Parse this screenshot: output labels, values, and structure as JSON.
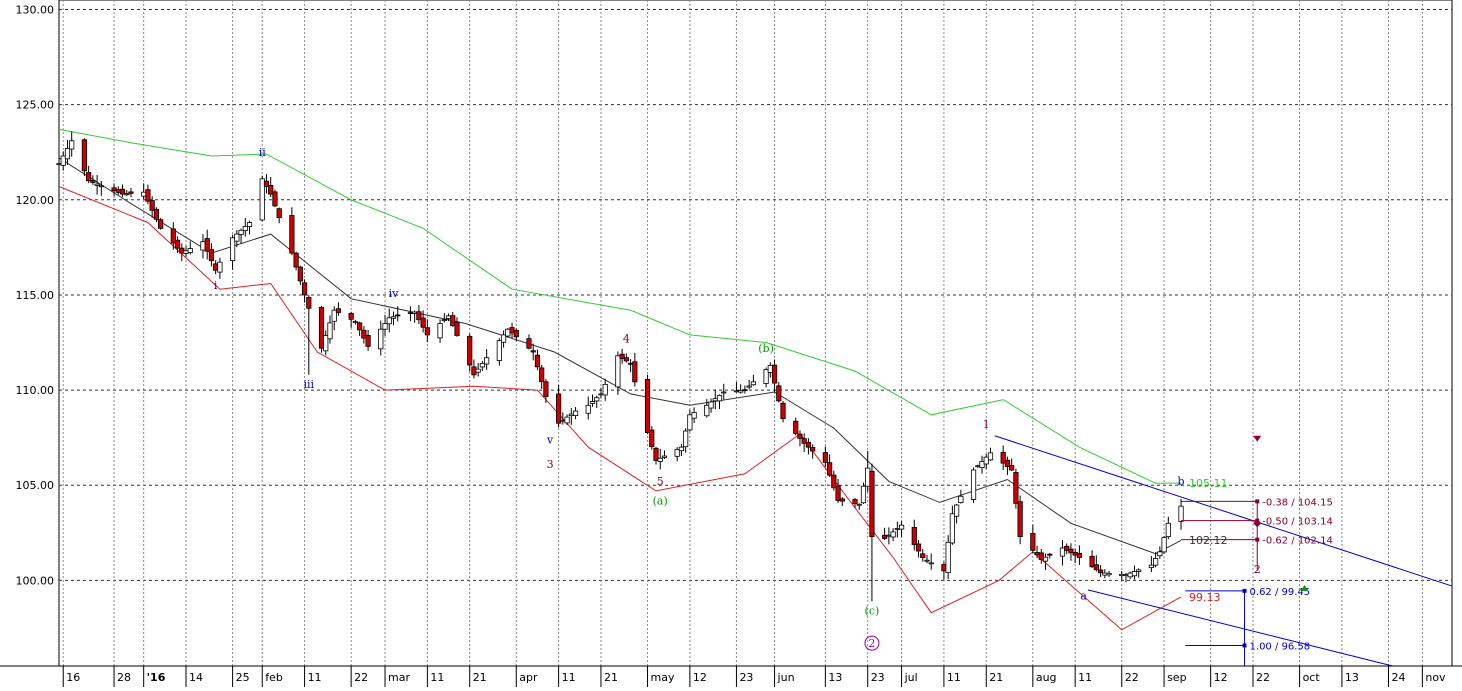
{
  "colors": {
    "grid": "#888888",
    "frame": "#000000",
    "bull_body": "#ffffff",
    "bear_body": "#cc0000",
    "ma": "#333333",
    "upper_band": "#33cc33",
    "lower_band": "#dd2222",
    "channel": "#0000cc",
    "blue_label": "#0000cc",
    "maroon_label": "#880033",
    "green_label": "#009900",
    "purple_label": "#990099",
    "fib_maroon": "#880033",
    "fib_blue": "#0000cc"
  },
  "chart_data": {
    "type": "candlestick",
    "ylim": [
      95.5,
      130.5
    ],
    "xlim": [
      "2015-12-15",
      "2016-11-08"
    ],
    "yticks": [
      "130.00",
      "125.00",
      "120.00",
      "115.00",
      "110.00",
      "105.00",
      "100.00"
    ],
    "xticks": [
      {
        "label": "16",
        "date": "2015-12-16"
      },
      {
        "label": "28",
        "date": "2015-12-28"
      },
      {
        "label": "'16",
        "date": "2016-01-04",
        "bold": true
      },
      {
        "label": "14",
        "date": "2016-01-14"
      },
      {
        "label": "25",
        "date": "2016-01-25"
      },
      {
        "label": "feb",
        "date": "2016-02-01"
      },
      {
        "label": "11",
        "date": "2016-02-11"
      },
      {
        "label": "22",
        "date": "2016-02-22"
      },
      {
        "label": "mar",
        "date": "2016-03-01"
      },
      {
        "label": "11",
        "date": "2016-03-11"
      },
      {
        "label": "21",
        "date": "2016-03-21"
      },
      {
        "label": "apr",
        "date": "2016-04-01"
      },
      {
        "label": "11",
        "date": "2016-04-11"
      },
      {
        "label": "21",
        "date": "2016-04-21"
      },
      {
        "label": "may",
        "date": "2016-05-02"
      },
      {
        "label": "12",
        "date": "2016-05-12"
      },
      {
        "label": "23",
        "date": "2016-05-23"
      },
      {
        "label": "jun",
        "date": "2016-06-01"
      },
      {
        "label": "13",
        "date": "2016-06-13"
      },
      {
        "label": "23",
        "date": "2016-06-23"
      },
      {
        "label": "jul",
        "date": "2016-07-01"
      },
      {
        "label": "11",
        "date": "2016-07-11"
      },
      {
        "label": "21",
        "date": "2016-07-21"
      },
      {
        "label": "aug",
        "date": "2016-08-01"
      },
      {
        "label": "11",
        "date": "2016-08-11"
      },
      {
        "label": "22",
        "date": "2016-08-22"
      },
      {
        "label": "sep",
        "date": "2016-09-01"
      },
      {
        "label": "12",
        "date": "2016-09-12"
      },
      {
        "label": "22",
        "date": "2016-09-22"
      },
      {
        "label": "oct",
        "date": "2016-10-03"
      },
      {
        "label": "13",
        "date": "2016-10-13"
      },
      {
        "label": "24",
        "date": "2016-10-24"
      },
      {
        "label": "nov",
        "date": "2016-11-01"
      }
    ],
    "price_anchors": [
      [
        "2015-12-15",
        121.9
      ],
      [
        "2015-12-18",
        123.1
      ],
      [
        "2015-12-22",
        121.0
      ],
      [
        "2015-12-30",
        120.3
      ],
      [
        "2016-01-04",
        120.4
      ],
      [
        "2016-01-08",
        118.5
      ],
      [
        "2016-01-13",
        117.2
      ],
      [
        "2016-01-18",
        117.8
      ],
      [
        "2016-01-21",
        116.3
      ],
      [
        "2016-01-25",
        118.0
      ],
      [
        "2016-01-29",
        118.8
      ],
      [
        "2016-02-01",
        121.1
      ],
      [
        "2016-02-03",
        120.3
      ],
      [
        "2016-02-08",
        117.2
      ],
      [
        "2016-02-11",
        115.0
      ],
      [
        "2016-02-15",
        112.2
      ],
      [
        "2016-02-18",
        114.2
      ],
      [
        "2016-02-23",
        113.6
      ],
      [
        "2016-02-26",
        112.3
      ],
      [
        "2016-03-02",
        113.8
      ],
      [
        "2016-03-08",
        114.1
      ],
      [
        "2016-03-11",
        112.9
      ],
      [
        "2016-03-16",
        113.9
      ],
      [
        "2016-03-22",
        110.8
      ],
      [
        "2016-03-30",
        113.2
      ],
      [
        "2016-04-05",
        112.0
      ],
      [
        "2016-04-10",
        108.1
      ],
      [
        "2016-04-15",
        108.9
      ],
      [
        "2016-04-18",
        109.2
      ],
      [
        "2016-04-21",
        109.8
      ],
      [
        "2016-04-25",
        111.8
      ],
      [
        "2016-04-28",
        111.4
      ],
      [
        "2016-05-01",
        108.5
      ],
      [
        "2016-05-04",
        106.3
      ],
      [
        "2016-05-10",
        107.0
      ],
      [
        "2016-05-12",
        108.7
      ],
      [
        "2016-05-16",
        109.2
      ],
      [
        "2016-05-20",
        109.9
      ],
      [
        "2016-05-25",
        110.0
      ],
      [
        "2016-05-31",
        111.3
      ],
      [
        "2016-06-03",
        108.5
      ],
      [
        "2016-06-08",
        107.2
      ],
      [
        "2016-06-13",
        106.2
      ],
      [
        "2016-06-16",
        104.2
      ],
      [
        "2016-06-21",
        104.0
      ],
      [
        "2016-06-23",
        105.9
      ],
      [
        "2016-06-24",
        102.3
      ],
      [
        "2016-06-27",
        102.2
      ],
      [
        "2016-07-01",
        102.9
      ],
      [
        "2016-07-06",
        101.2
      ],
      [
        "2016-07-11",
        100.5
      ],
      [
        "2016-07-13",
        103.5
      ],
      [
        "2016-07-18",
        105.8
      ],
      [
        "2016-07-22",
        106.7
      ],
      [
        "2016-07-27",
        105.8
      ],
      [
        "2016-07-29",
        102.3
      ],
      [
        "2016-08-03",
        101.1
      ],
      [
        "2016-08-08",
        101.7
      ],
      [
        "2016-08-12",
        101.2
      ],
      [
        "2016-08-17",
        100.4
      ],
      [
        "2016-08-23",
        100.3
      ],
      [
        "2016-08-29",
        100.8
      ],
      [
        "2016-08-31",
        101.5
      ],
      [
        "2016-09-02",
        103.0
      ],
      [
        "2016-09-05",
        103.9
      ]
    ],
    "wicks": [
      {
        "date": "2016-06-24",
        "low": 98.9
      },
      {
        "date": "2016-02-12",
        "low": 110.8
      },
      {
        "date": "2016-06-23",
        "high": 106.8
      },
      {
        "date": "2015-12-18",
        "high": 123.6
      }
    ],
    "series": [
      {
        "name": "",
        "role": "moving-average",
        "values": [
          [
            "2015-12-15",
            122.2
          ],
          [
            "2016-01-01",
            119.8
          ],
          [
            "2016-01-20",
            117.2
          ],
          [
            "2016-02-03",
            118.2
          ],
          [
            "2016-02-22",
            114.8
          ],
          [
            "2016-03-20",
            113.5
          ],
          [
            "2016-04-10",
            112.0
          ],
          [
            "2016-04-28",
            109.8
          ],
          [
            "2016-05-12",
            109.2
          ],
          [
            "2016-06-01",
            109.9
          ],
          [
            "2016-06-15",
            108.0
          ],
          [
            "2016-06-28",
            105.2
          ],
          [
            "2016-07-10",
            104.1
          ],
          [
            "2016-07-26",
            105.3
          ],
          [
            "2016-08-10",
            103.0
          ],
          [
            "2016-08-30",
            101.4
          ],
          [
            "2016-09-05",
            102.1
          ]
        ]
      },
      {
        "name": "",
        "role": "upper-band",
        "values": [
          [
            "2015-12-15",
            123.7
          ],
          [
            "2016-01-01",
            123.0
          ],
          [
            "2016-01-20",
            122.3
          ],
          [
            "2016-02-02",
            122.4
          ],
          [
            "2016-02-22",
            120.0
          ],
          [
            "2016-03-10",
            118.5
          ],
          [
            "2016-03-31",
            115.3
          ],
          [
            "2016-04-28",
            114.2
          ],
          [
            "2016-05-12",
            112.9
          ],
          [
            "2016-05-30",
            112.5
          ],
          [
            "2016-06-20",
            111.0
          ],
          [
            "2016-07-08",
            108.7
          ],
          [
            "2016-07-25",
            109.5
          ],
          [
            "2016-08-12",
            107.0
          ],
          [
            "2016-08-30",
            105.1
          ],
          [
            "2016-09-05",
            105.11
          ]
        ]
      },
      {
        "name": "",
        "role": "lower-band",
        "values": [
          [
            "2015-12-15",
            120.7
          ],
          [
            "2016-01-05",
            118.8
          ],
          [
            "2016-01-22",
            115.3
          ],
          [
            "2016-02-03",
            115.6
          ],
          [
            "2016-02-14",
            112.0
          ],
          [
            "2016-03-01",
            110.0
          ],
          [
            "2016-03-22",
            110.2
          ],
          [
            "2016-04-06",
            110.0
          ],
          [
            "2016-04-18",
            107.0
          ],
          [
            "2016-05-04",
            104.7
          ],
          [
            "2016-05-25",
            105.6
          ],
          [
            "2016-06-07",
            107.7
          ],
          [
            "2016-06-18",
            104.4
          ],
          [
            "2016-06-29",
            101.2
          ],
          [
            "2016-07-08",
            98.3
          ],
          [
            "2016-07-24",
            100.0
          ],
          [
            "2016-08-01",
            101.5
          ],
          [
            "2016-08-22",
            97.4
          ],
          [
            "2016-09-05",
            99.13
          ]
        ]
      }
    ],
    "trendlines": [
      {
        "role": "channel-upper",
        "from": [
          "2016-07-23",
          107.6
        ],
        "to": [
          "2016-11-08",
          99.7
        ]
      },
      {
        "role": "channel-lower",
        "from": [
          "2016-08-14",
          99.5
        ],
        "to": [
          "2016-10-25",
          95.5
        ]
      }
    ],
    "wave_labels": [
      {
        "text": "ii",
        "date": "2016-02-01",
        "price": 122.3,
        "color": "blue_label"
      },
      {
        "text": "i",
        "date": "2016-01-21",
        "price": 115.3,
        "color": "blue_label"
      },
      {
        "text": "iii",
        "date": "2016-02-12",
        "price": 110.1,
        "color": "blue_label"
      },
      {
        "text": "iv",
        "date": "2016-03-03",
        "price": 114.9,
        "color": "blue_label"
      },
      {
        "text": "v",
        "date": "2016-04-09",
        "price": 107.2,
        "color": "blue_label"
      },
      {
        "text": "3",
        "date": "2016-04-09",
        "price": 105.9,
        "color": "maroon_label"
      },
      {
        "text": "4",
        "date": "2016-04-27",
        "price": 112.5,
        "color": "maroon_label"
      },
      {
        "text": "5",
        "date": "2016-05-05",
        "price": 105.0,
        "color": "maroon_label"
      },
      {
        "text": "(a)",
        "date": "2016-05-05",
        "price": 104.0,
        "color": "green_label"
      },
      {
        "text": "(b)",
        "date": "2016-05-30",
        "price": 112.0,
        "color": "green_label"
      },
      {
        "text": "(c)",
        "date": "2016-06-24",
        "price": 98.2,
        "color": "green_label"
      },
      {
        "text": "1",
        "date": "2016-07-21",
        "price": 108.0,
        "color": "maroon_label"
      },
      {
        "text": "a",
        "date": "2016-08-13",
        "price": 99.0,
        "color": "blue_label"
      },
      {
        "text": "b",
        "date": "2016-09-05",
        "price": 105.0,
        "color": "blue_label"
      },
      {
        "text": "2",
        "date": "2016-09-23",
        "price": 100.4,
        "color": "maroon_label"
      }
    ],
    "circled_labels": [
      {
        "text": "2",
        "date": "2016-06-24",
        "price": 96.7,
        "color": "purple_label"
      }
    ],
    "value_labels": [
      {
        "text": "105.11",
        "price": 105.11,
        "color": "upper_band"
      },
      {
        "text": "102.12",
        "price": 102.12,
        "color": "ma"
      },
      {
        "text": "99.13",
        "price": 99.13,
        "color": "lower_band"
      }
    ],
    "fib_levels": [
      {
        "text": "-0.38 / 104.15",
        "price": 104.15,
        "color": "fib_maroon"
      },
      {
        "text": "-0.50 / 103.14",
        "price": 103.14,
        "color": "fib_maroon"
      },
      {
        "text": "-0.62 / 102.14",
        "price": 102.14,
        "color": "fib_maroon"
      },
      {
        "text": "0.62 / 99.45",
        "price": 99.45,
        "color": "fib_blue"
      },
      {
        "text": "1.00 / 96.58",
        "price": 96.58,
        "color": "fib_blue"
      }
    ]
  }
}
